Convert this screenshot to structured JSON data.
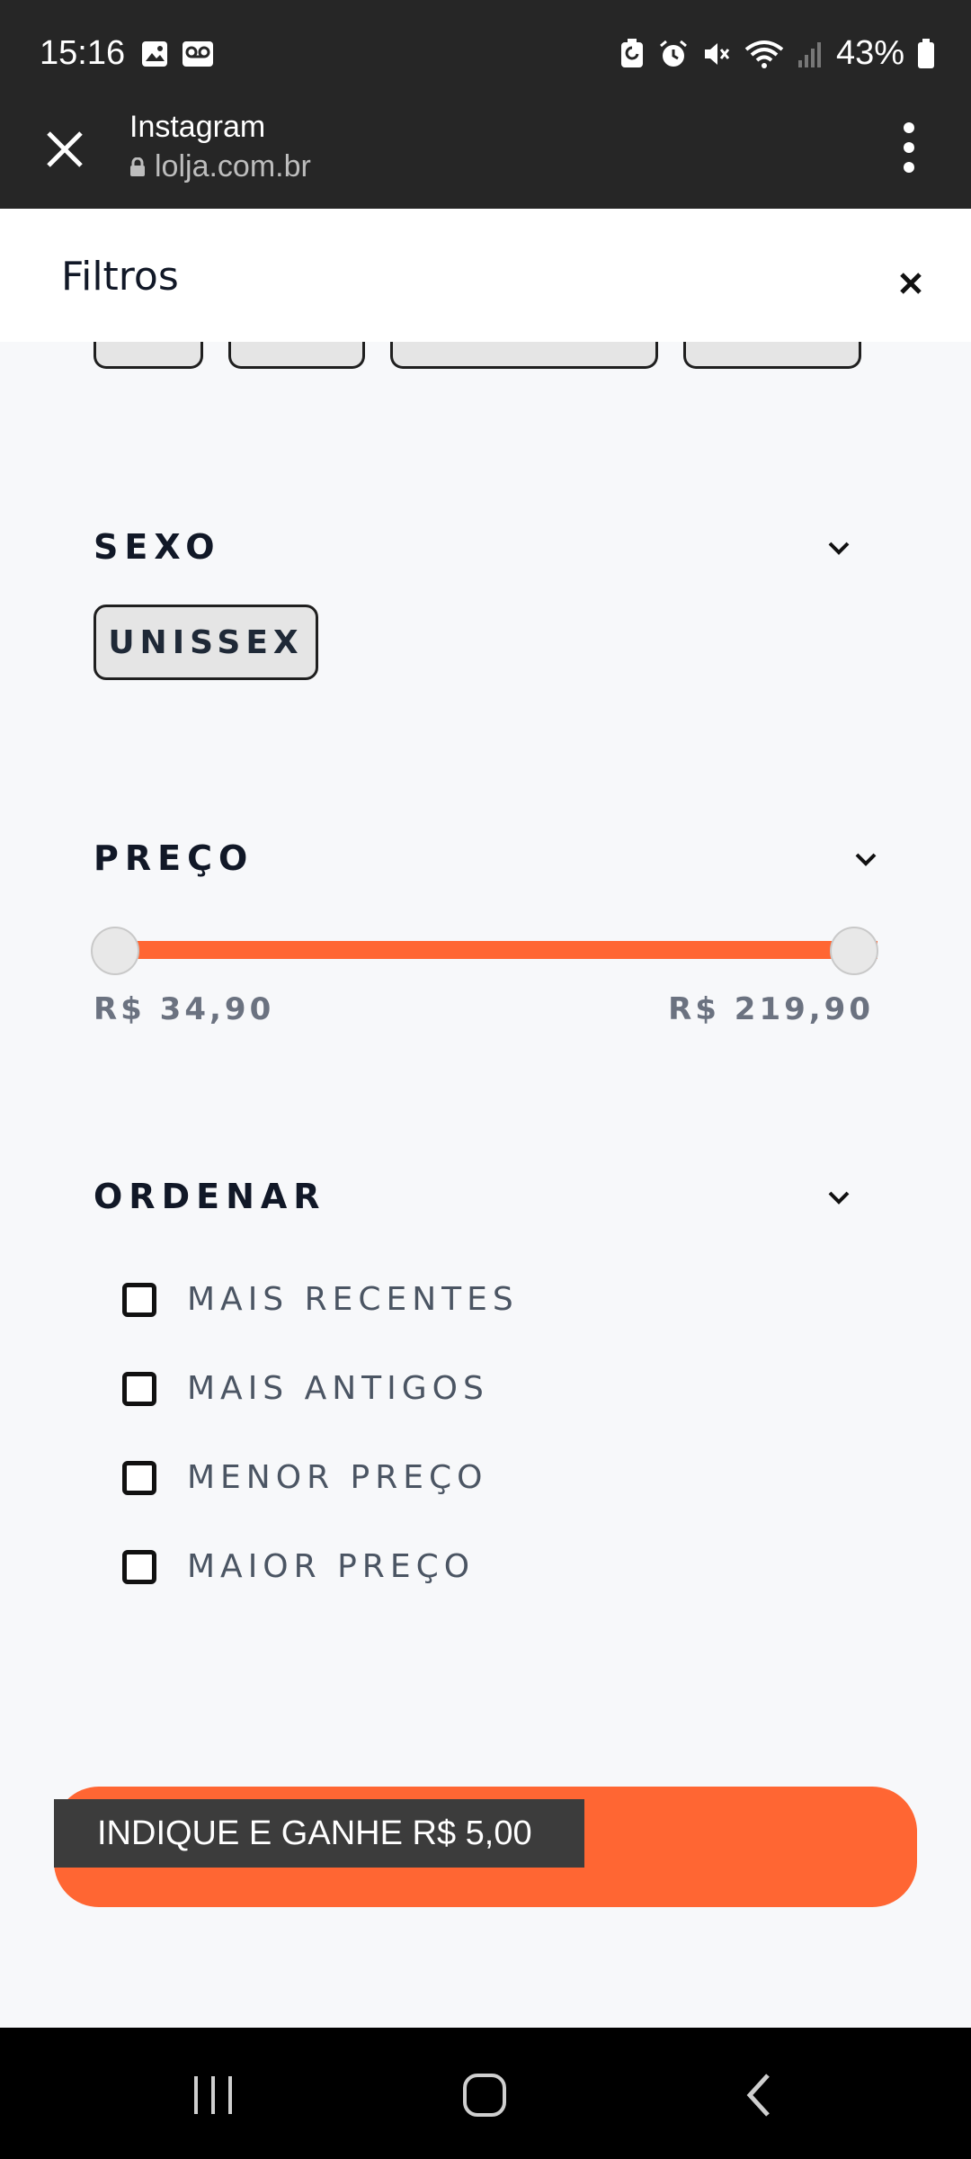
{
  "status_bar": {
    "time": "15:16",
    "battery": "43%",
    "icons": [
      "gallery-icon",
      "voicemail-icon",
      "battery-saver-icon",
      "alarm-icon",
      "mute-icon",
      "wifi-icon",
      "signal-icon",
      "battery-icon"
    ]
  },
  "browser": {
    "title": "Instagram",
    "url": "lolja.com.br"
  },
  "filters": {
    "title": "Filtros",
    "sections": {
      "sexo": {
        "title": "SEXO",
        "chip": "UNISSEX"
      },
      "preco": {
        "title": "PREÇO",
        "min_label": "R$ 34,90",
        "max_label": "R$ 219,90",
        "range_start": 0.0,
        "range_end": 1.0
      },
      "ordenar": {
        "title": "ORDENAR",
        "options": [
          "MAIS RECENTES",
          "MAIS ANTIGOS",
          "MENOR PREÇO",
          "MAIOR PREÇO"
        ]
      }
    }
  },
  "cta": {
    "tooltip": "INDIQUE E GANHE R$ 5,00"
  },
  "colors": {
    "accent": "#ff6633",
    "dark": "#262626"
  }
}
